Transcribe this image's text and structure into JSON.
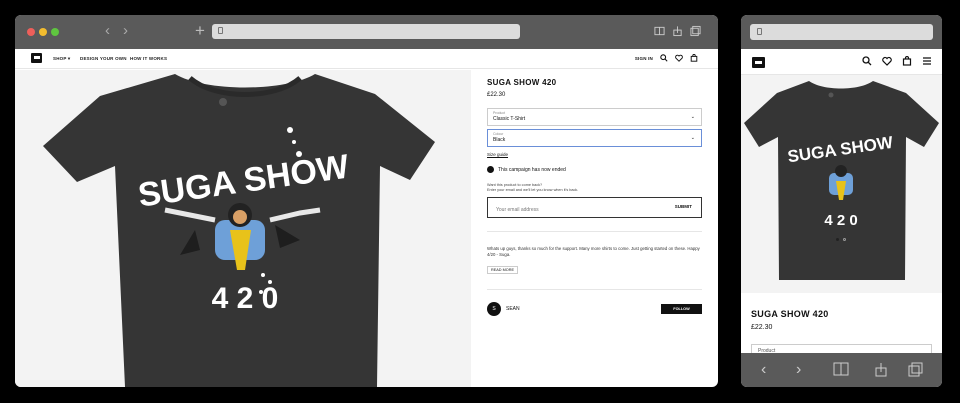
{
  "desktop": {
    "nav": {
      "shop": "SHOP ▾",
      "design": "DESIGN YOUR OWN",
      "how": "HOW IT WORKS",
      "signin": "SIGN IN"
    },
    "product": {
      "title": "SUGA SHOW 420",
      "price": "£22.30",
      "product_label": "Product",
      "product_value": "Classic T-Shirt",
      "colour_label": "Colour",
      "colour_value": "Black",
      "size_guide": "Size guide",
      "ended": "This campaign has now ended",
      "want_line1": "Want this product to come back?",
      "want_line2": "Enter your email and we'll let you know when it's back.",
      "email_placeholder": "Your email address",
      "submit": "SUBMIT",
      "description": "Whats up guys, thanks so much for the support. Many more shirts to come. Just getting started on these. Happy 4/20 - Suga.",
      "read_more": "READ MORE",
      "seller_initial": "S",
      "seller_name": "SEAN",
      "follow": "FOLLOW"
    },
    "artwork": {
      "headline": "SUGA SHOW",
      "number": "4 2 0"
    }
  },
  "mobile": {
    "title": "SUGA SHOW 420",
    "price": "£22.30",
    "product_label": "Product",
    "carousel_active": 1,
    "carousel_count": 2
  },
  "colors": {
    "shirt": "#353535",
    "canvas": "#f3f3f3",
    "chrome": "#5a5a5a",
    "accent_select": "#6a8fd8"
  }
}
